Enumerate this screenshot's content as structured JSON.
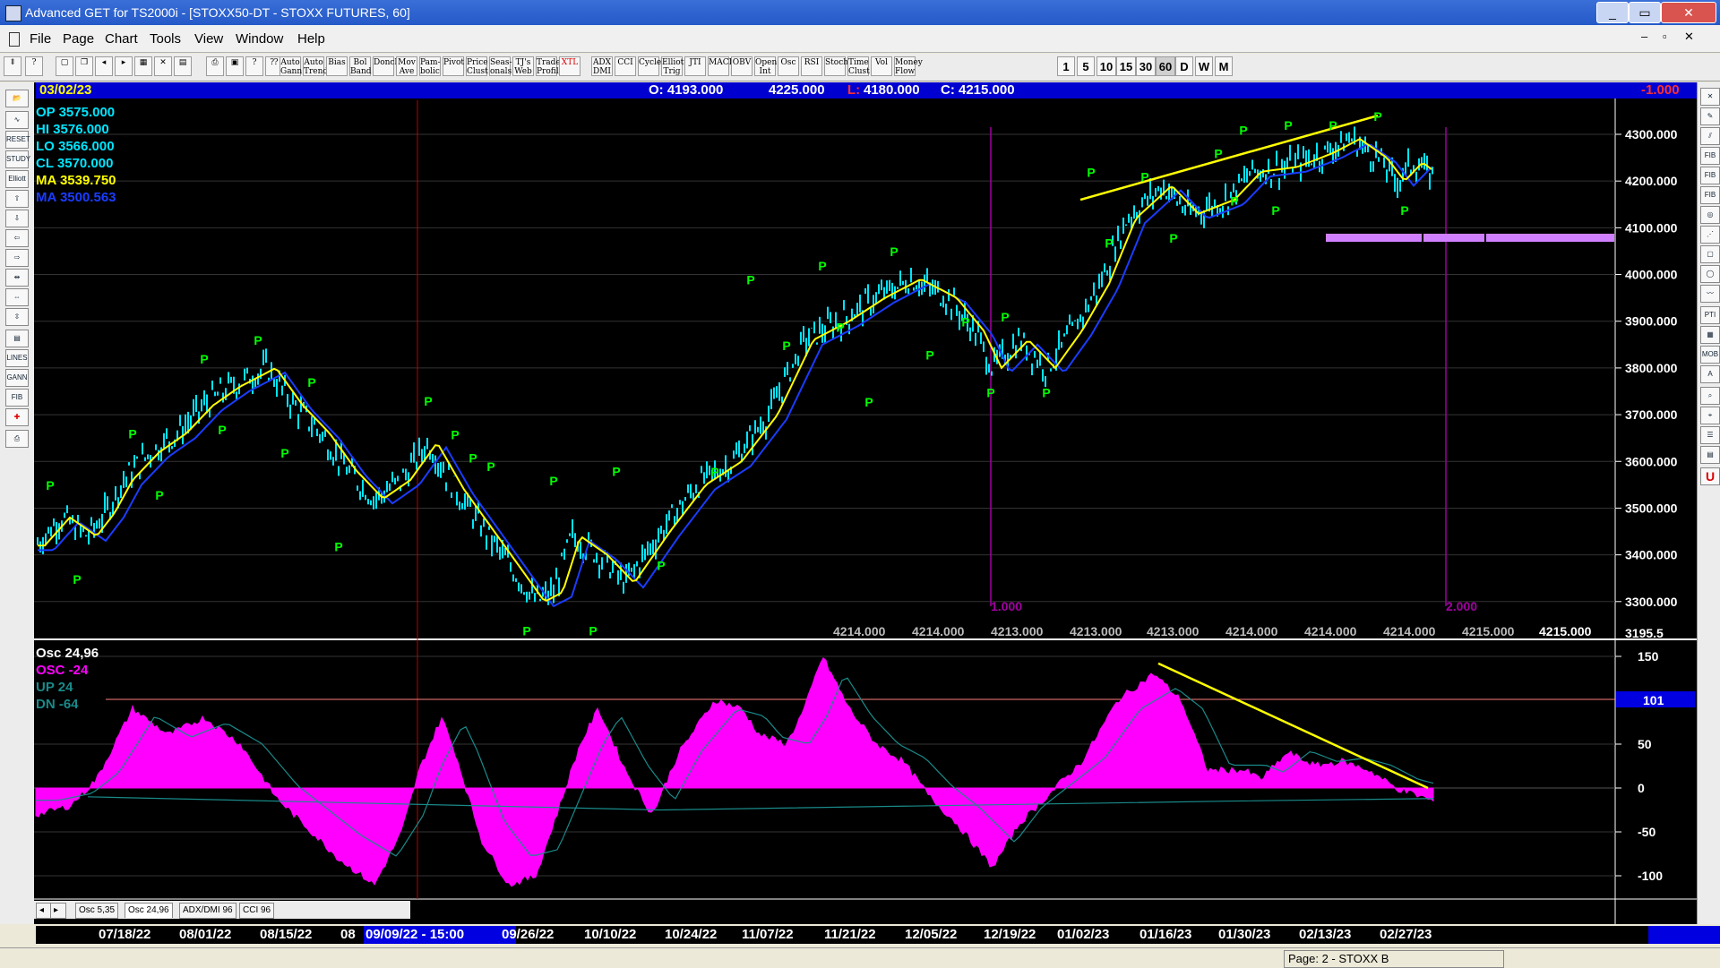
{
  "window": {
    "title": "Advanced GET for TS2000i - [STOXX50-DT - STOXX FUTURES, 60]"
  },
  "menu": [
    "File",
    "Page",
    "Chart",
    "Tools",
    "View",
    "Window",
    "Help"
  ],
  "toolbar": {
    "studies": [
      "Auto Gann",
      "Auto Trend",
      "Bias",
      "Bol Band",
      "Donch",
      "Mov Ave",
      "Pam-bolic",
      "Pivot",
      "Price Clust",
      "Seas-onals",
      "TJ's Web",
      "Trade Profile",
      "XTL",
      "ADX DMI",
      "CCI",
      "Cycles",
      "Elliott Trig",
      "JTI",
      "MACD",
      "OBV",
      "Open Int",
      "Osc",
      "RSI",
      "Stoch",
      "Time Clust",
      "Vol",
      "Money Flow"
    ],
    "periods": [
      "1",
      "5",
      "10",
      "15",
      "30",
      "60",
      "D",
      "W",
      "M"
    ]
  },
  "info": {
    "date": "03/02/23",
    "o": "O: 4193.000",
    "h": "4225.000",
    "l_label": "L:",
    "l": "4180.000",
    "c": "C: 4215.000",
    "right": "-1.000"
  },
  "legend": {
    "op": "OP  3575.000",
    "hi": "HI   3576.000",
    "lo": "LO  3566.000",
    "cl": "CL  3570.000",
    "ma1": "MA  3539.750",
    "ma2": "MA  3500.563"
  },
  "price_axis": [
    "4300.000",
    "4200.000",
    "4100.000",
    "4000.000",
    "3900.000",
    "3800.000",
    "3700.000",
    "3600.000",
    "3500.000",
    "3400.000",
    "3300.000"
  ],
  "price_bottom_label": "3195.5",
  "time_markers": {
    "m1": "1.000",
    "m2": "2.000"
  },
  "bottom_values": [
    "4214.000",
    "4214.000",
    "4213.000",
    "4213.000",
    "4213.000",
    "4214.000",
    "4214.000",
    "4214.000",
    "4215.000",
    "4215.000"
  ],
  "osc": {
    "title": "Osc 24,96",
    "osc": "OSC -24",
    "up": "UP  24",
    "dn": "DN  -64",
    "axis": [
      "150",
      "50",
      "0",
      "-50",
      "-100"
    ],
    "level": "101"
  },
  "tabs": [
    "Osc 5,35",
    "Osc 24,96",
    "ADX/DMI 96",
    "CCI 96"
  ],
  "dates": [
    "07/18/22",
    "08/01/22",
    "08/15/22",
    "08",
    "09/09/22 - 15:00",
    "09/26/22",
    "10/10/22",
    "10/24/22",
    "11/07/22",
    "11/21/22",
    "12/05/22",
    "12/19/22",
    "01/02/23",
    "01/16/23",
    "01/30/23",
    "02/13/23",
    "02/27/23"
  ],
  "status": {
    "page": "Page: 2 - STOXX B"
  },
  "colors": {
    "price": "#00e5ff",
    "ma_fast": "#ffff00",
    "ma_slow": "#1a3cff",
    "osc": "#ff00ff",
    "pivot": "#00ff00",
    "marker": "#a000a0"
  },
  "chart_data": {
    "type": "line",
    "x_range": [
      "07/18/22",
      "03/02/23"
    ],
    "ylim": [
      3195.5,
      4325
    ],
    "pivots": [
      "P",
      "P",
      "P",
      "P",
      "P",
      "P"
    ]
  }
}
